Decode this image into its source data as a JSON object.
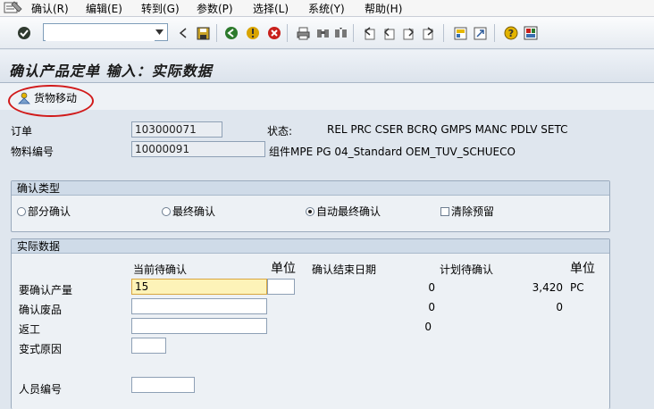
{
  "menu": {
    "items": [
      "确认(R)",
      "编辑(E)",
      "转到(G)",
      "参数(P)",
      "选择(L)",
      "系统(Y)",
      "帮助(H)"
    ]
  },
  "toolbar": {
    "command_value": "",
    "icons": [
      "enter-check-icon",
      "back-icon",
      "save-icon",
      "back-green-icon",
      "exit-icon",
      "cancel-icon",
      "print-icon",
      "find-icon",
      "find-next-icon",
      "first-page-icon",
      "prev-page-icon",
      "next-page-icon",
      "last-page-icon",
      "create-session-icon",
      "shortcut-icon",
      "help-icon",
      "layout-icon"
    ]
  },
  "title": "确认产品定单 输入：实际数据",
  "app_toolbar": {
    "goods_movement_label": "货物移动"
  },
  "header": {
    "order_label": "订单",
    "order_value": "103000071",
    "status_label": "状态:",
    "status_value": "REL  PRC  CSER BCRQ GMPS MANC PDLV SETC",
    "material_label": "物料编号",
    "material_value": "10000091",
    "material_desc": "组件MPE PG 04_Standard OEM_TUV_SCHUECO"
  },
  "confirm_type": {
    "title": "确认类型",
    "options": [
      "部分确认",
      "最终确认",
      "自动最终确认"
    ],
    "selected_index": 2,
    "clear_reservation_label": "清除预留",
    "clear_reservation_checked": false
  },
  "actual_data": {
    "title": "实际数据",
    "col_current": "当前待确认",
    "col_unit": "单位",
    "col_end_date": "确认结束日期",
    "col_planned": "计划待确认",
    "col_unit2": "单位",
    "rows": [
      {
        "label": "要确认产量",
        "value": "15",
        "unit": "",
        "confirmed": "0",
        "planned": "3,420",
        "planned_unit": "PC"
      },
      {
        "label": "确认废品",
        "value": "",
        "confirmed": "0",
        "planned": "0"
      },
      {
        "label": "返工",
        "value": "",
        "confirmed": "0"
      },
      {
        "label": "变式原因",
        "value": ""
      },
      {
        "label": "人员编号",
        "value": ""
      }
    ]
  },
  "colors": {
    "highlight_oval": "#d11a1a",
    "focus_field": "#fdf3b8"
  }
}
